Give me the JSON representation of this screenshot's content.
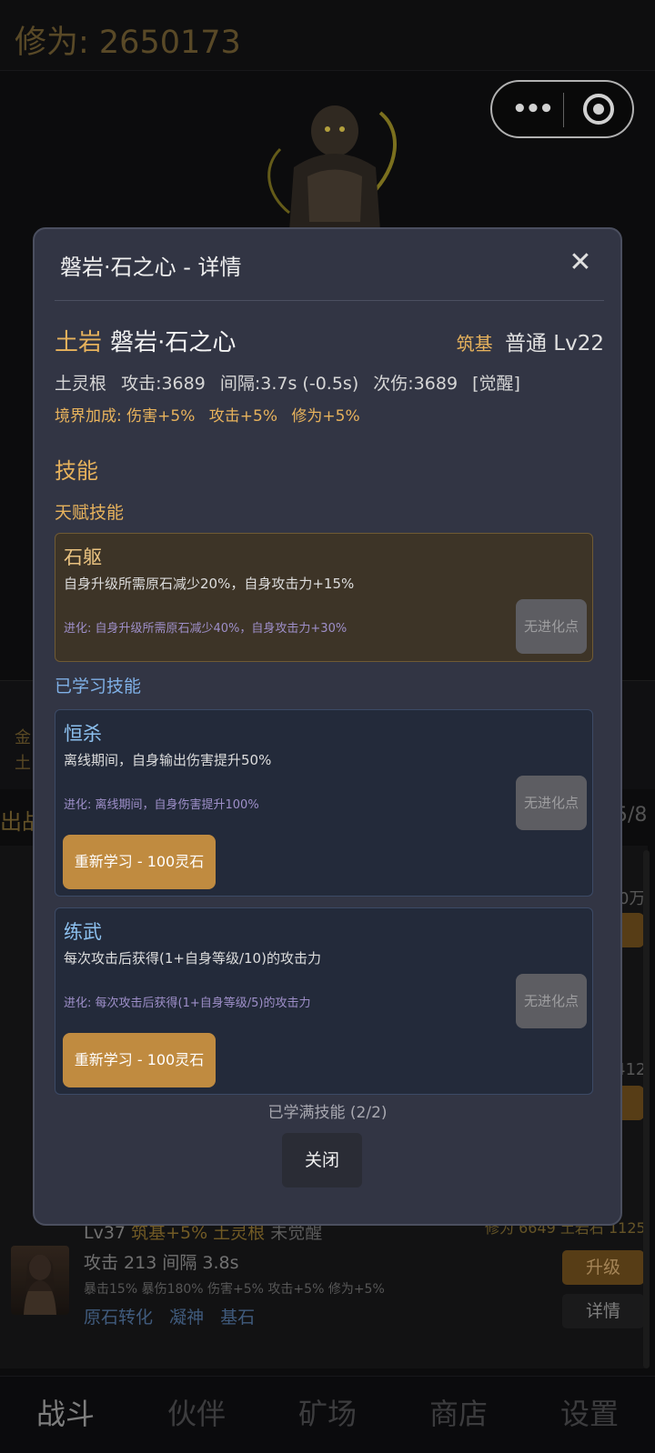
{
  "header": {
    "cultivation": "修为: 2650173"
  },
  "modal": {
    "title": "磐岩·石之心 - 详情",
    "close_icon": "✕",
    "element": "土岩",
    "name": "磐岩·石之心",
    "realm": "筑基",
    "rarity_level": "普通 Lv22",
    "stats": [
      "土灵根",
      "攻击:3689",
      "间隔:3.7s (-0.5s)",
      "次伤:3689",
      "[觉醒]"
    ],
    "bonus": [
      "境界加成: 伤害+5%",
      "攻击+5%",
      "修为+5%"
    ],
    "skills_title": "技能",
    "talent_title": "天赋技能",
    "talent": {
      "name": "石躯",
      "desc": "自身升级所需原石减少20%，自身攻击力+15%",
      "evo": "进化: 自身升级所需原石减少40%，自身攻击力+30%",
      "evo_button": "无进化点"
    },
    "learned_title": "已学习技能",
    "learned": [
      {
        "name": "恒杀",
        "desc": "离线期间，自身输出伤害提升50%",
        "evo": "进化: 离线期间，自身伤害提升100%",
        "evo_button": "无进化点",
        "relearn": "重新学习 - 100灵石"
      },
      {
        "name": "练武",
        "desc": "每次攻击后获得(1+自身等级/10)的攻击力",
        "evo": "进化: 每次攻击后获得(1+自身等级/5)的攻击力",
        "evo_button": "无进化点",
        "relearn": "重新学习 - 100灵石"
      }
    ],
    "learned_full": "已学满技能 (2/2)",
    "close_button": "关闭"
  },
  "background": {
    "strip_left": [
      "金",
      "土"
    ],
    "team_label": "出战",
    "team_count": "5/8",
    "right_nums": [
      "0万",
      "412"
    ],
    "member": {
      "level": "Lv37",
      "realm_bonus": "筑基+5%",
      "root": "土灵根",
      "awaken": "未觉醒",
      "attack_interval": "攻击 213  间隔 3.8s",
      "small_stats": "暴击15% 暴伤180% 伤害+5% 攻击+5% 修为+5%",
      "skills": [
        "原石转化",
        "凝神",
        "基石"
      ],
      "resources": "修为 6649  土岩石 1125",
      "upgrade": "升级",
      "detail": "详情"
    }
  },
  "nav": [
    "战斗",
    "伙伴",
    "矿场",
    "商店",
    "设置"
  ]
}
